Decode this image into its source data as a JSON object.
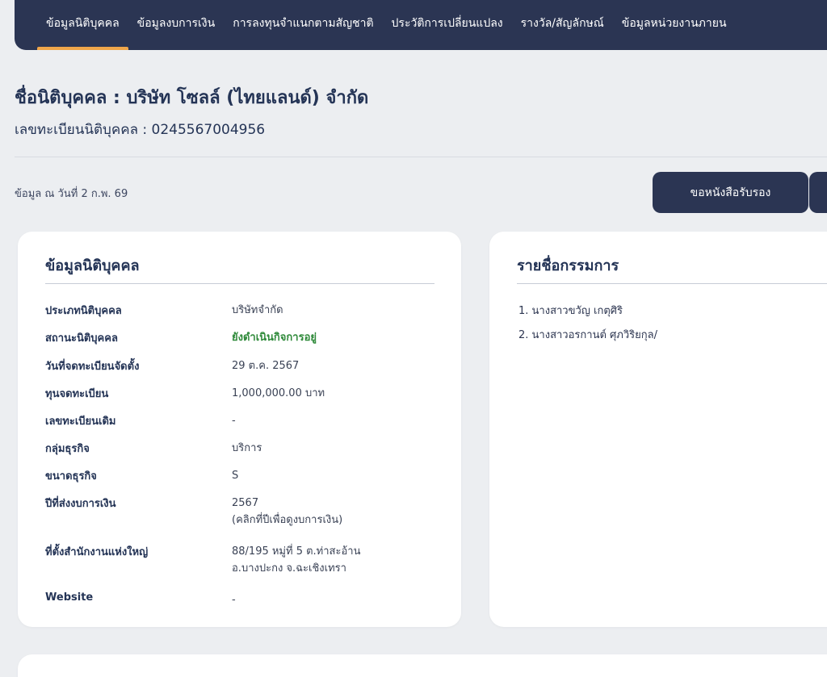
{
  "nav": {
    "tabs": [
      {
        "label": "ข้อมูลนิติบุคคล",
        "active": true
      },
      {
        "label": "ข้อมูลงบการเงิน"
      },
      {
        "label": "การลงทุนจำแนกตามสัญชาติ"
      },
      {
        "label": "ประวัติการเปลี่ยนแปลง"
      },
      {
        "label": "รางวัล/สัญลักษณ์"
      },
      {
        "label": "ข้อมูลหน่วยงานภายน"
      }
    ]
  },
  "header": {
    "company_name": "ชื่อนิติบุคคล : บริษัท โซลล์ (ไทยแลนด์) จำกัด",
    "registration": "เลขทะเบียนนิติบุคคล : 0245567004956",
    "as_of": "ข้อมูล ณ วันที่ 2 ก.พ. 69",
    "cert_button": "ขอหนังสือรับรอง"
  },
  "info_card": {
    "title": "ข้อมูลนิติบุคคล",
    "rows": [
      {
        "label": "ประเภทนิติบุคคล",
        "value": "บริษัทจำกัด"
      },
      {
        "label": "สถานะนิติบุคคล",
        "value": "ยังดำเนินกิจการอยู่"
      },
      {
        "label": "วันที่จดทะเบียนจัดตั้ง",
        "value": "29 ต.ค. 2567"
      },
      {
        "label": "ทุนจดทะเบียน",
        "value": "1,000,000.00 บาท"
      },
      {
        "label": "เลขทะเบียนเดิม",
        "value": "-"
      },
      {
        "label": "กลุ่มธุรกิจ",
        "value": "บริการ"
      },
      {
        "label": "ขนาดธุรกิจ",
        "value": "S"
      },
      {
        "label": "ปีที่ส่งงบการเงิน",
        "value": "2567",
        "value2": "(คลิกที่ปีเพื่อดูงบการเงิน)"
      },
      {
        "label": "ที่ตั้งสำนักงานแห่งใหญ่",
        "value": "88/195 หมู่ที่ 5 ต.ท่าสะอ้าน",
        "value2": "อ.บางปะกง จ.ฉะเชิงเทรา"
      },
      {
        "label": "Website",
        "value": "-"
      }
    ],
    "status_color": "#2f8a3a"
  },
  "directors_card": {
    "title": "รายชื่อกรรมการ",
    "items": [
      "1. นางสาวขวัญ เกตุศิริ",
      "2. นางสาวอรกานต์ ศุภวิริยกุล/"
    ]
  },
  "colors": {
    "nav_bg": "#2b3553",
    "accent": "#f0a64a",
    "page_bg": "#eceef1"
  }
}
